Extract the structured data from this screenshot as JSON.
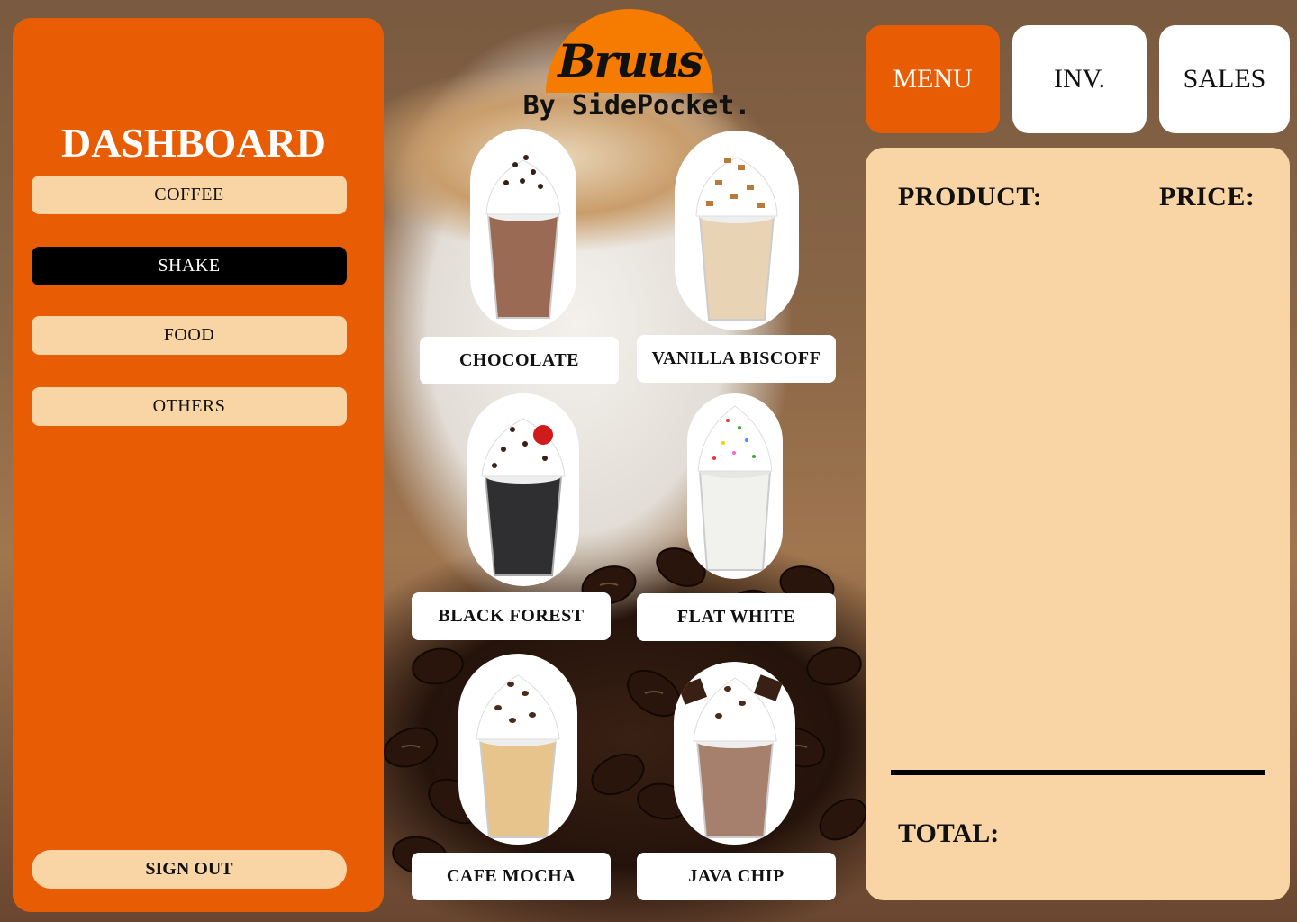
{
  "sidebar": {
    "title": "DASHBOARD",
    "categories": [
      {
        "label": "COFFEE",
        "active": false
      },
      {
        "label": "SHAKE",
        "active": true
      },
      {
        "label": "FOOD",
        "active": false
      },
      {
        "label": "OTHERS",
        "active": false
      }
    ],
    "sign_out": "SIGN OUT"
  },
  "logo": {
    "name": "Bruus",
    "tagline": "By SidePocket."
  },
  "products": [
    {
      "name": "CHOCOLATE",
      "drink_color": "#9b6a55",
      "topping": "chocolate-shavings"
    },
    {
      "name": "VANILLA BISCOFF",
      "drink_color": "#e8d4b4",
      "topping": "biscoff-crumbs"
    },
    {
      "name": "BLACK FOREST",
      "drink_color": "#2f2f31",
      "topping": "cherry-and-shavings"
    },
    {
      "name": "FLAT WHITE",
      "drink_color": "#f1f1ee",
      "topping": "sprinkles"
    },
    {
      "name": "CAFE MOCHA",
      "drink_color": "#e6c48c",
      "topping": "coffee-beans"
    },
    {
      "name": "JAVA CHIP",
      "drink_color": "#a77f6d",
      "topping": "chocolate-chips"
    }
  ],
  "tabs": [
    {
      "label": "MENU",
      "active": true
    },
    {
      "label": "INV.",
      "active": false
    },
    {
      "label": "SALES",
      "active": false
    }
  ],
  "order": {
    "product_header": "PRODUCT:",
    "price_header": "PRICE:",
    "total_label": "TOTAL:"
  },
  "colors": {
    "brand_orange": "#e85d04",
    "logo_orange": "#f57c00",
    "cream": "#f9d5a5",
    "active_black": "#000000"
  }
}
